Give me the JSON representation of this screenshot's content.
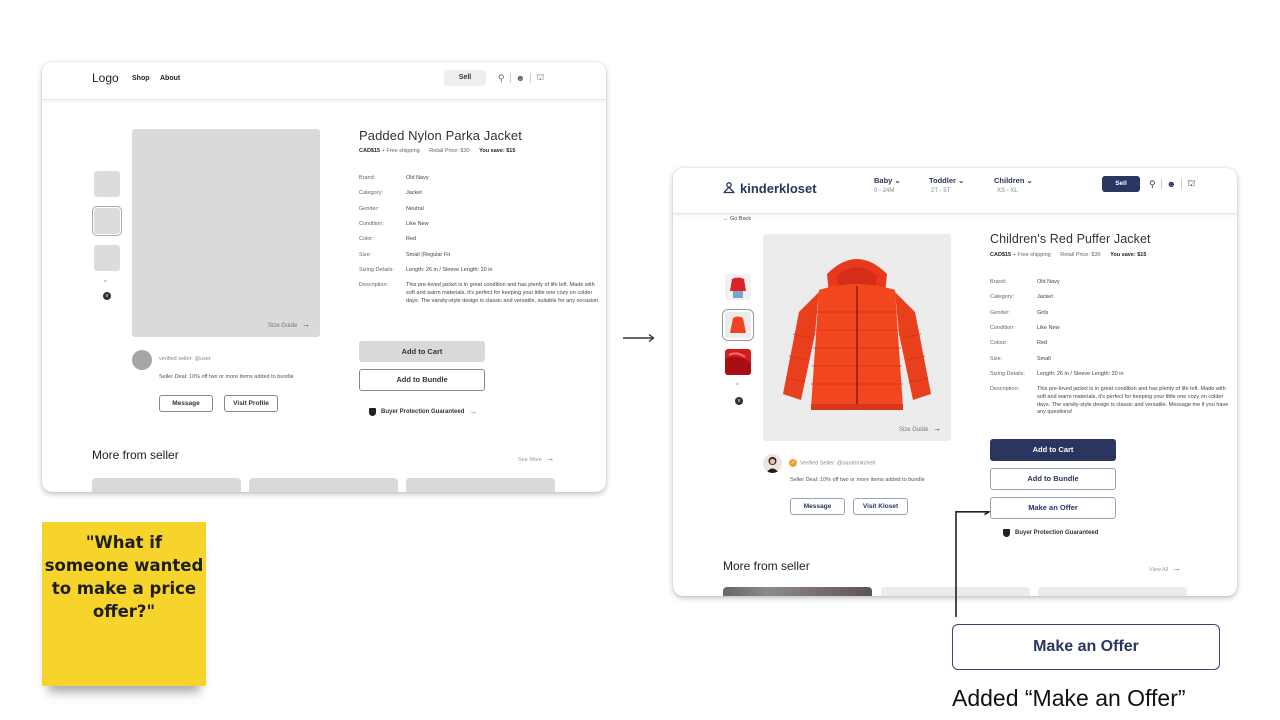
{
  "wireframe": {
    "header": {
      "logo": "Logo",
      "nav": [
        "Shop",
        "About"
      ],
      "sell_label": "Sell",
      "icons": [
        "search-icon",
        "user-icon",
        "basket-icon"
      ]
    },
    "gallery": {
      "thumbnails": 3,
      "selected_thumbnail": 2,
      "size_guide_label": "Size Guide",
      "size_guide_arrow": "→"
    },
    "seller": {
      "handle_text": "verified seller: @user",
      "deal_text": "Seller Deal: 10% off two or more items added to bundle",
      "message_label": "Message",
      "profile_label": "Visit Profile"
    },
    "product": {
      "title": "Padded Nylon Parka Jacket",
      "price": "CAD$15",
      "shipping": "+ Free shipping",
      "retail": "Retail Price: $30",
      "savings": "You save: $15",
      "specs": [
        {
          "label": "Brand:",
          "value": "Old Navy"
        },
        {
          "label": "Category:",
          "value": "Jacket"
        },
        {
          "label": "Gender:",
          "value": "Neutral"
        },
        {
          "label": "Condition:",
          "value": "Like New"
        },
        {
          "label": "Color:",
          "value": "Red"
        },
        {
          "label": "Size:",
          "value": "Small (Regular Fit"
        },
        {
          "label": "Sizing Details:",
          "value": "Length: 26 in / Sleeve Length: 20 in"
        },
        {
          "label": "Description:",
          "value": "This pre-loved jacket is in great condition and has plenty of life left. Made with soft and warm materials, it's perfect for keeping your little one cozy on colder days. The varsity-style design is classic and versatile, suitable for any occasion."
        }
      ],
      "add_to_cart": "Add to Cart",
      "add_to_bundle": "Add to Bundle",
      "protection": "Buyer Protection Guaranteed",
      "protection_arrow": "→"
    },
    "more": {
      "title": "More from seller",
      "link": "See More",
      "link_arrow": "→"
    }
  },
  "sticky_note": {
    "text": "\"What if someone wanted to make a price offer?\"",
    "color": "#f7d42c"
  },
  "transition_arrow": "→",
  "hifi": {
    "header": {
      "brand": "kinderkloset",
      "categories": [
        {
          "label": "Baby",
          "range": "0 - 24M"
        },
        {
          "label": "Toddler",
          "range": "2T - 5T"
        },
        {
          "label": "Children",
          "range": "XS - XL"
        }
      ],
      "sell_label": "Sell",
      "icons": [
        "search-icon",
        "user-icon",
        "basket-icon"
      ],
      "accent": "#2a3560"
    },
    "go_back": "Go Back",
    "gallery": {
      "thumbnails": 3,
      "selected_thumbnail": 2,
      "size_guide_label": "Size Guide",
      "size_guide_arrow": "→"
    },
    "seller": {
      "handle_text": "Verified Seller: @sarahmitchell",
      "deal_text": "Seller Deal: 10% off two or more items added to bundle",
      "message_label": "Message",
      "profile_label": "Visit Kloset"
    },
    "product": {
      "title": "Children's Red Puffer Jacket",
      "price": "CAD$15",
      "shipping": "+ Free shipping",
      "retail": "Retail Price: $30",
      "savings": "You save: $15",
      "specs": [
        {
          "label": "Brand:",
          "value": "Old Navy"
        },
        {
          "label": "Category:",
          "value": "Jacket"
        },
        {
          "label": "Gender:",
          "value": "Girls"
        },
        {
          "label": "Condition:",
          "value": "Like New"
        },
        {
          "label": "Colour:",
          "value": "Red"
        },
        {
          "label": "Size:",
          "value": "Small"
        },
        {
          "label": "Sizing Details:",
          "value": "Length: 26 in / Sleeve Length: 20 in"
        },
        {
          "label": "Description:",
          "value": "This pre-loved jacket is in great condition and has plenty of life left. Made with soft and warm materials, it's perfect for keeping your little one cozy on colder days. The varsity-style design is classic and versatile. Message me if you have any questions!"
        }
      ],
      "add_to_cart": "Add to Cart",
      "add_to_bundle": "Add to Bundle",
      "make_offer": "Make an Offer",
      "protection": "Buyer Protection Guaranteed"
    },
    "more": {
      "title": "More from seller",
      "link": "View All",
      "link_arrow": "→"
    }
  },
  "annotation": {
    "button_label": "Make an Offer",
    "caption": "Added “Make an Offer”"
  }
}
